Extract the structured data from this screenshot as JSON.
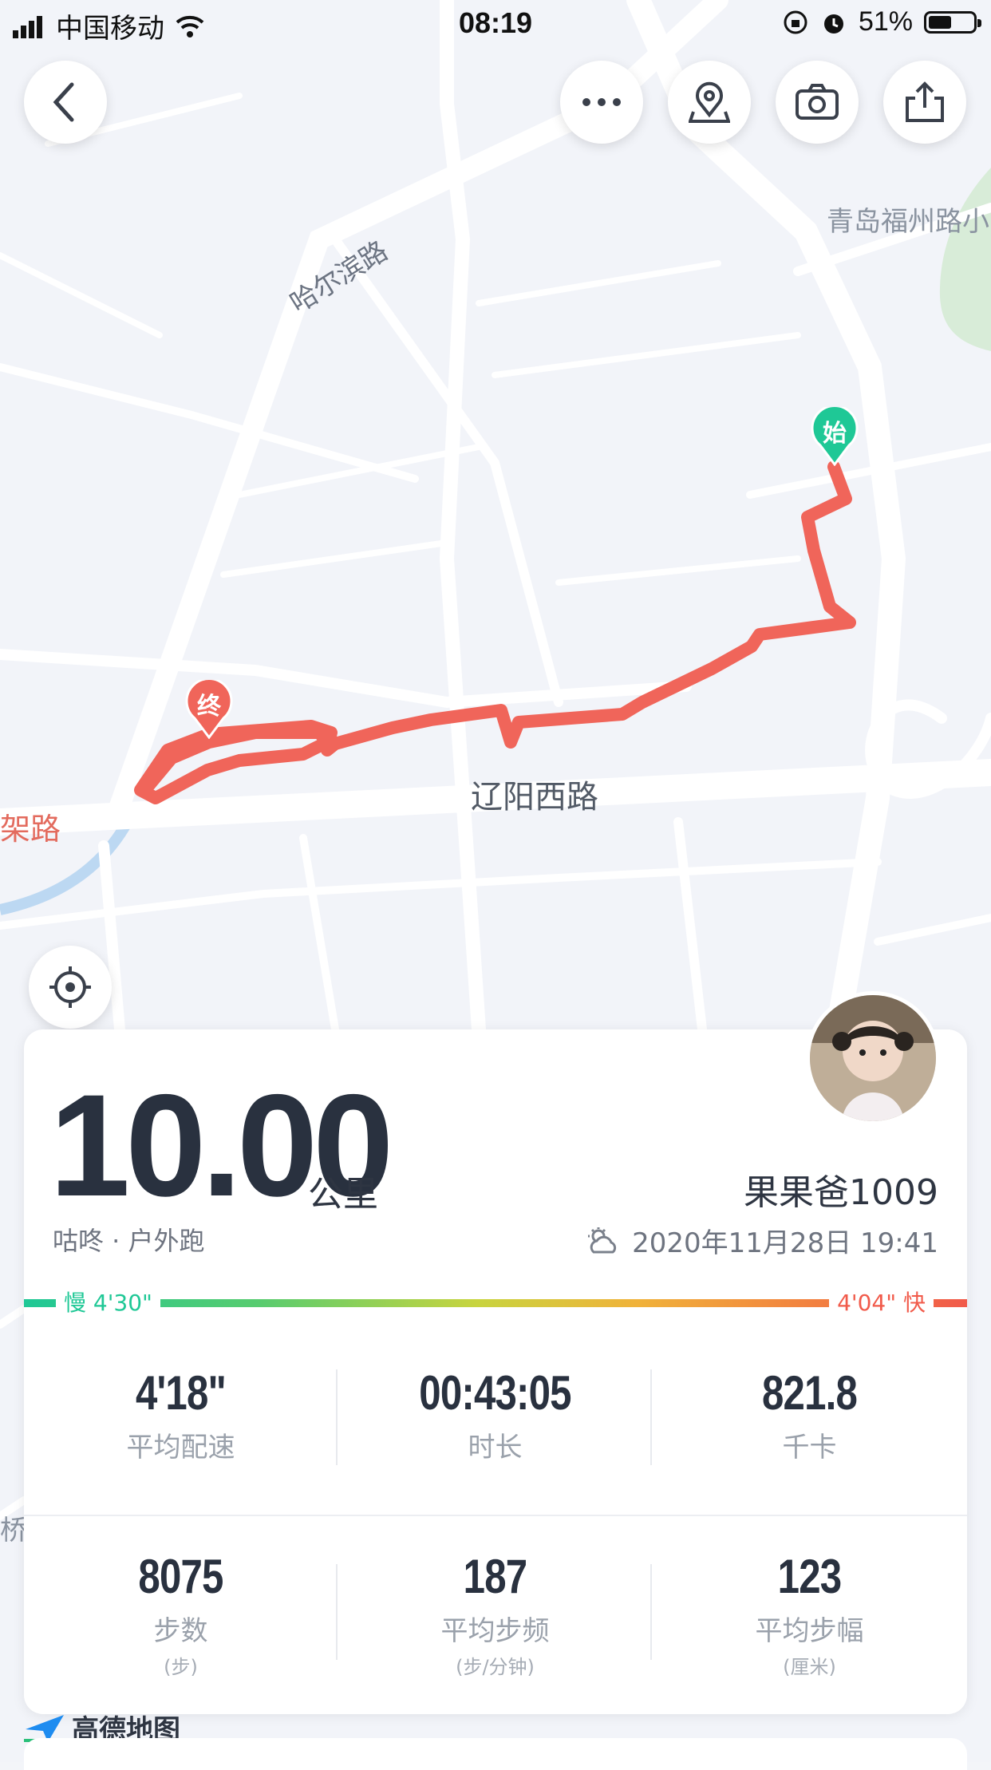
{
  "status_bar": {
    "carrier": "中国移动",
    "time": "08:19",
    "battery_percent": "51%",
    "battery_level": 0.51
  },
  "map": {
    "labels": {
      "road1": "哈尔滨路",
      "road2": "辽阳西路",
      "place1": "青岛福州路小",
      "road_edge": "架路",
      "bridge": "桥"
    },
    "start_pin": "始",
    "end_pin": "终",
    "route_color": "#f0655a",
    "provider": "高德地图"
  },
  "summary": {
    "distance": "10.00",
    "unit": "公里",
    "sport": "咕咚 · 户外跑",
    "user": "果果爸1009",
    "datetime": "2020年11月28日 19:41",
    "slow_label": "慢 4'30\"",
    "fast_label": "4'04\" 快"
  },
  "stats": [
    {
      "value": "4'18\"",
      "label": "平均配速",
      "sub": ""
    },
    {
      "value": "00:43:05",
      "label": "时长",
      "sub": ""
    },
    {
      "value": "821.8",
      "label": "千卡",
      "sub": ""
    },
    {
      "value": "8075",
      "label": "步数",
      "sub": "(步)"
    },
    {
      "value": "187",
      "label": "平均步频",
      "sub": "(步/分钟)"
    },
    {
      "value": "123",
      "label": "平均步幅",
      "sub": "(厘米)"
    }
  ],
  "colors": {
    "accent_green": "#1fc896",
    "accent_red": "#f15a4a",
    "text_dark": "#29313f"
  }
}
